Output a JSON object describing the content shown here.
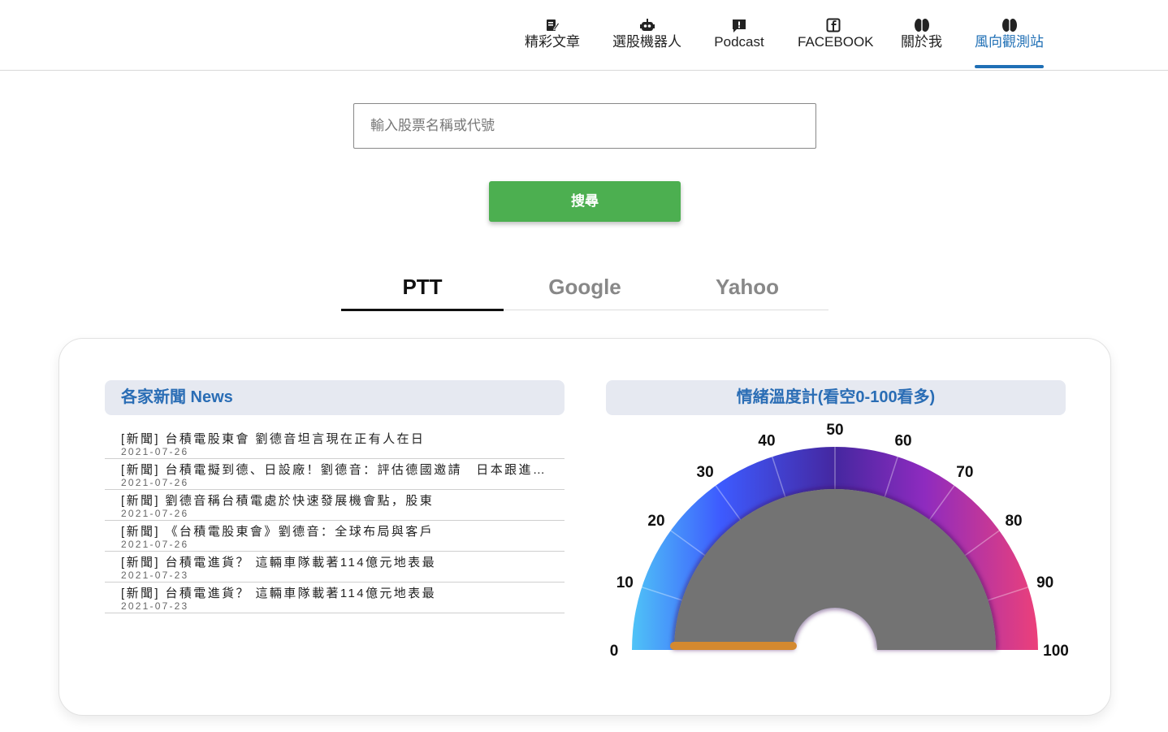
{
  "nav": {
    "items": [
      {
        "label": "精彩文章",
        "icon": "edit-icon"
      },
      {
        "label": "選股機器人",
        "icon": "robot-icon"
      },
      {
        "label": "Podcast",
        "icon": "chat-alert-icon"
      },
      {
        "label": "FACEBOOK",
        "icon": "facebook-icon"
      },
      {
        "label": "關於我",
        "icon": "brain-icon"
      },
      {
        "label": "風向觀測站",
        "icon": "brain-icon"
      }
    ],
    "active_label": "風向觀測站"
  },
  "search": {
    "placeholder": "輸入股票名稱或代號",
    "button_label": "搜尋"
  },
  "tabs": [
    "PTT",
    "Google",
    "Yahoo"
  ],
  "news": {
    "heading": "各家新聞 News",
    "items": [
      {
        "title": "[新聞] 台積電股東會 劉德音坦言現在正有人在日",
        "date": "2021-07-26"
      },
      {
        "title": "[新聞] 台積電擬到德、日設廠！劉德音：評估德國邀請　日本跟進中",
        "date": "2021-07-26"
      },
      {
        "title": "[新聞] 劉德音稱台積電處於快速發展機會點，股東",
        "date": "2021-07-26"
      },
      {
        "title": "[新聞] 《台積電股東會》劉德音：全球布局與客戶",
        "date": "2021-07-26"
      },
      {
        "title": "[新聞] 台積電進貨？ 這輛車隊載著114億元地表最",
        "date": "2021-07-23"
      },
      {
        "title": "[新聞] 台積電進貨？ 這輛車隊載著114億元地表最",
        "date": "2021-07-23"
      }
    ]
  },
  "gauge": {
    "heading": "情緒溫度計(看空0-100看多)",
    "min": 0,
    "max": 100,
    "ticks": [
      0,
      10,
      20,
      30,
      40,
      50,
      60,
      70,
      80,
      90,
      100
    ],
    "value": 0,
    "colors": {
      "low": "#4fc3f7",
      "mid_low": "#3d5afe",
      "mid": "#4527a0",
      "mid_high": "#7b2cbf",
      "high": "#ec407a",
      "inner": "#737373",
      "needle": "#d4892f"
    }
  },
  "colors": {
    "accent_blue": "#1f6fb5",
    "search_green": "#4caf50",
    "panel_bg": "#e6e9f1"
  }
}
